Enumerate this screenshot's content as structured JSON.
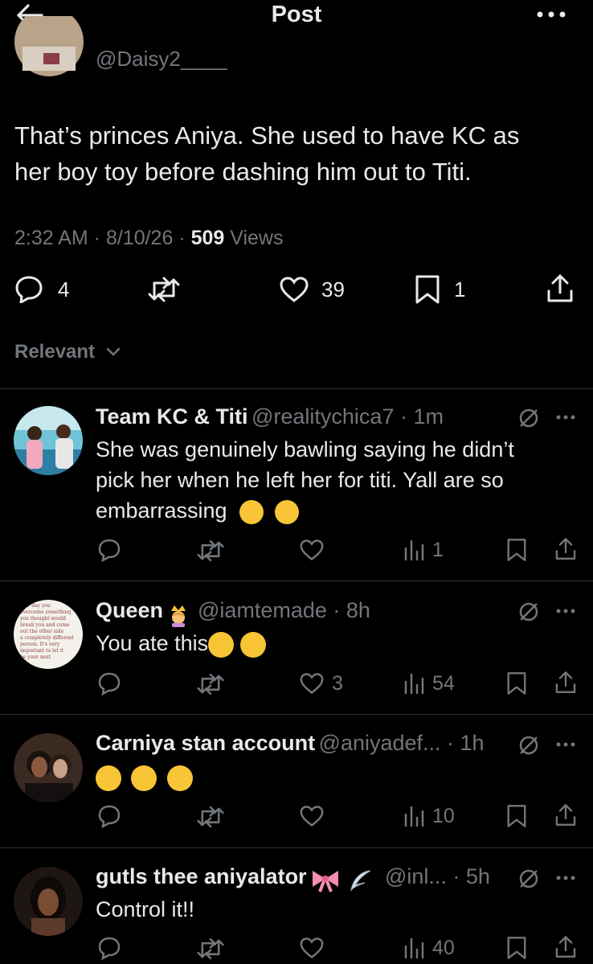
{
  "header": {
    "title": "Post"
  },
  "post": {
    "handle": "@Daisy2____",
    "text_line1": "That’s princes Aniya. She used to have KC as",
    "text_line2": "her boy toy before dashing him out to Titi.",
    "time": "2:32 AM · 8/10/26 · ",
    "views_count": "509",
    "views_label": " Views",
    "replies": "4",
    "likes": "39",
    "bookmarks": "1"
  },
  "sort": {
    "label": "Relevant"
  },
  "replies": [
    {
      "name": "Team KC & Titi",
      "handle": "@realitychica7 · 1m",
      "line1": "She was genuinely bawling saying he didn’t",
      "line2": "pick her when he left her for titi. Yall are so",
      "line3": "embarrassing",
      "views": "1"
    },
    {
      "name": "Queen",
      "handle": "@iamtemade · 8h",
      "line1": "You ate this",
      "likes": "3",
      "views": "54",
      "avatar_text": [
        "One day you",
        "overcome something",
        "you thought would",
        "break you and come",
        "out the other side",
        "a completely different",
        "person. It's very",
        "important to let it",
        "be your next"
      ]
    },
    {
      "name": "Carniya stan account",
      "handle": "@aniyadef... · 1h",
      "views": "10"
    },
    {
      "name": "gutls thee aniyalator",
      "handle": "@inl... · 5h",
      "line1": "Control it!!",
      "views": "40"
    }
  ],
  "icons": [
    "back-arrow-icon",
    "more-icon",
    "reply-icon",
    "repost-icon",
    "like-icon",
    "bookmark-icon",
    "share-icon",
    "chevron-down-icon",
    "grok-icon",
    "views-icon"
  ]
}
